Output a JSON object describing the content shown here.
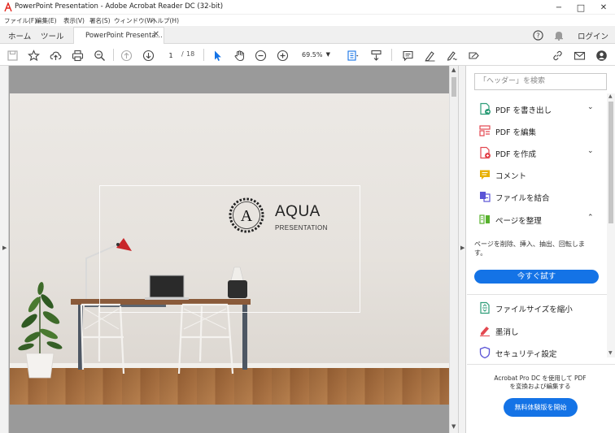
{
  "window": {
    "title": "PowerPoint Presentation - Adobe Acrobat Reader DC (32-bit)",
    "controls": {
      "minimize": "−",
      "maximize": "□",
      "close": "✕"
    }
  },
  "menu": [
    "ファイル(F)",
    "編集(E)",
    "表示(V)",
    "署名(S)",
    "ウィンドウ(W)",
    "ヘルプ(H)"
  ],
  "tabs": {
    "home": "ホーム",
    "tools": "ツール",
    "document": "PowerPoint Presenta...",
    "close": "✕",
    "login": "ログイン"
  },
  "toolbar": {
    "current_page": "1",
    "page_separator": "/",
    "total_pages": "18",
    "zoom": "69.5%"
  },
  "slide": {
    "logo_letter": "A",
    "title": "AQUA",
    "subtitle": "PRESENTATION"
  },
  "panel": {
    "search_placeholder": "「ヘッダー」を検索",
    "tools": [
      {
        "label": "PDF を書き出し",
        "icon": "export-pdf-icon",
        "color": "#2d9d78",
        "chevron": "⌄"
      },
      {
        "label": "PDF を編集",
        "icon": "edit-pdf-icon",
        "color": "#e34850",
        "chevron": ""
      },
      {
        "label": "PDF を作成",
        "icon": "create-pdf-icon",
        "color": "#e34850",
        "chevron": "⌄"
      },
      {
        "label": "コメント",
        "icon": "comment-icon",
        "color": "#e8b100",
        "chevron": ""
      },
      {
        "label": "ファイルを結合",
        "icon": "combine-files-icon",
        "color": "#5b54d6",
        "chevron": ""
      },
      {
        "label": "ページを整理",
        "icon": "organize-pages-icon",
        "color": "#57b12d",
        "chevron": "⌃"
      }
    ],
    "organize_desc": "ページを削除、挿入、抽出、回転します。",
    "try_button": "今すぐ試す",
    "more_tools": [
      {
        "label": "ファイルサイズを縮小",
        "icon": "compress-icon",
        "color": "#2d9d78"
      },
      {
        "label": "墨消し",
        "icon": "redact-icon",
        "color": "#e34850"
      },
      {
        "label": "セキュリティ設定",
        "icon": "protect-icon",
        "color": "#5b54d6"
      }
    ],
    "promo_text": "Acrobat Pro DC を使用して PDF を変換および編集する",
    "trial_button": "無料体験版を開始"
  },
  "colors": {
    "accent": "#1473e6"
  }
}
